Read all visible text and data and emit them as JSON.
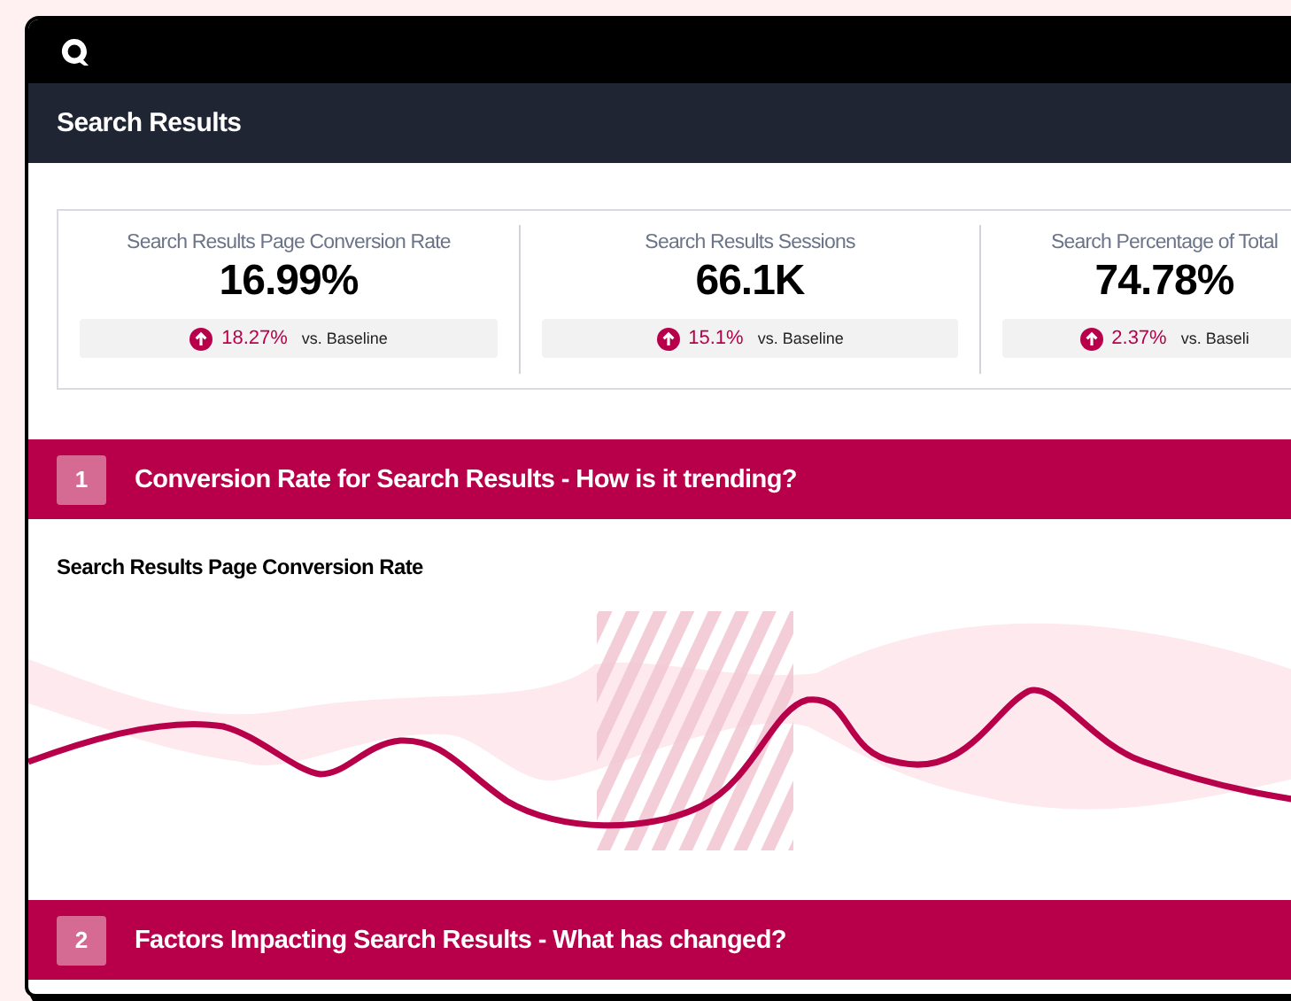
{
  "page_title": "Search Results",
  "kpis": [
    {
      "label": "Search Results Page Conversion Rate",
      "value": "16.99%",
      "delta": "18.27%",
      "comparison": "vs. Baseline"
    },
    {
      "label": "Search Results Sessions",
      "value": "66.1K",
      "delta": "15.1%",
      "comparison": "vs. Baseline"
    },
    {
      "label": "Search Percentage of Total",
      "value": "74.78%",
      "delta": "2.37%",
      "comparison": "vs. Baseli"
    }
  ],
  "sections": [
    {
      "number": "1",
      "title": "Conversion Rate for Search Results - How is it trending?",
      "chart_title": "Search Results Page Conversion Rate"
    },
    {
      "number": "2",
      "title": "Factors Impacting Search Results - What has changed?"
    }
  ]
}
